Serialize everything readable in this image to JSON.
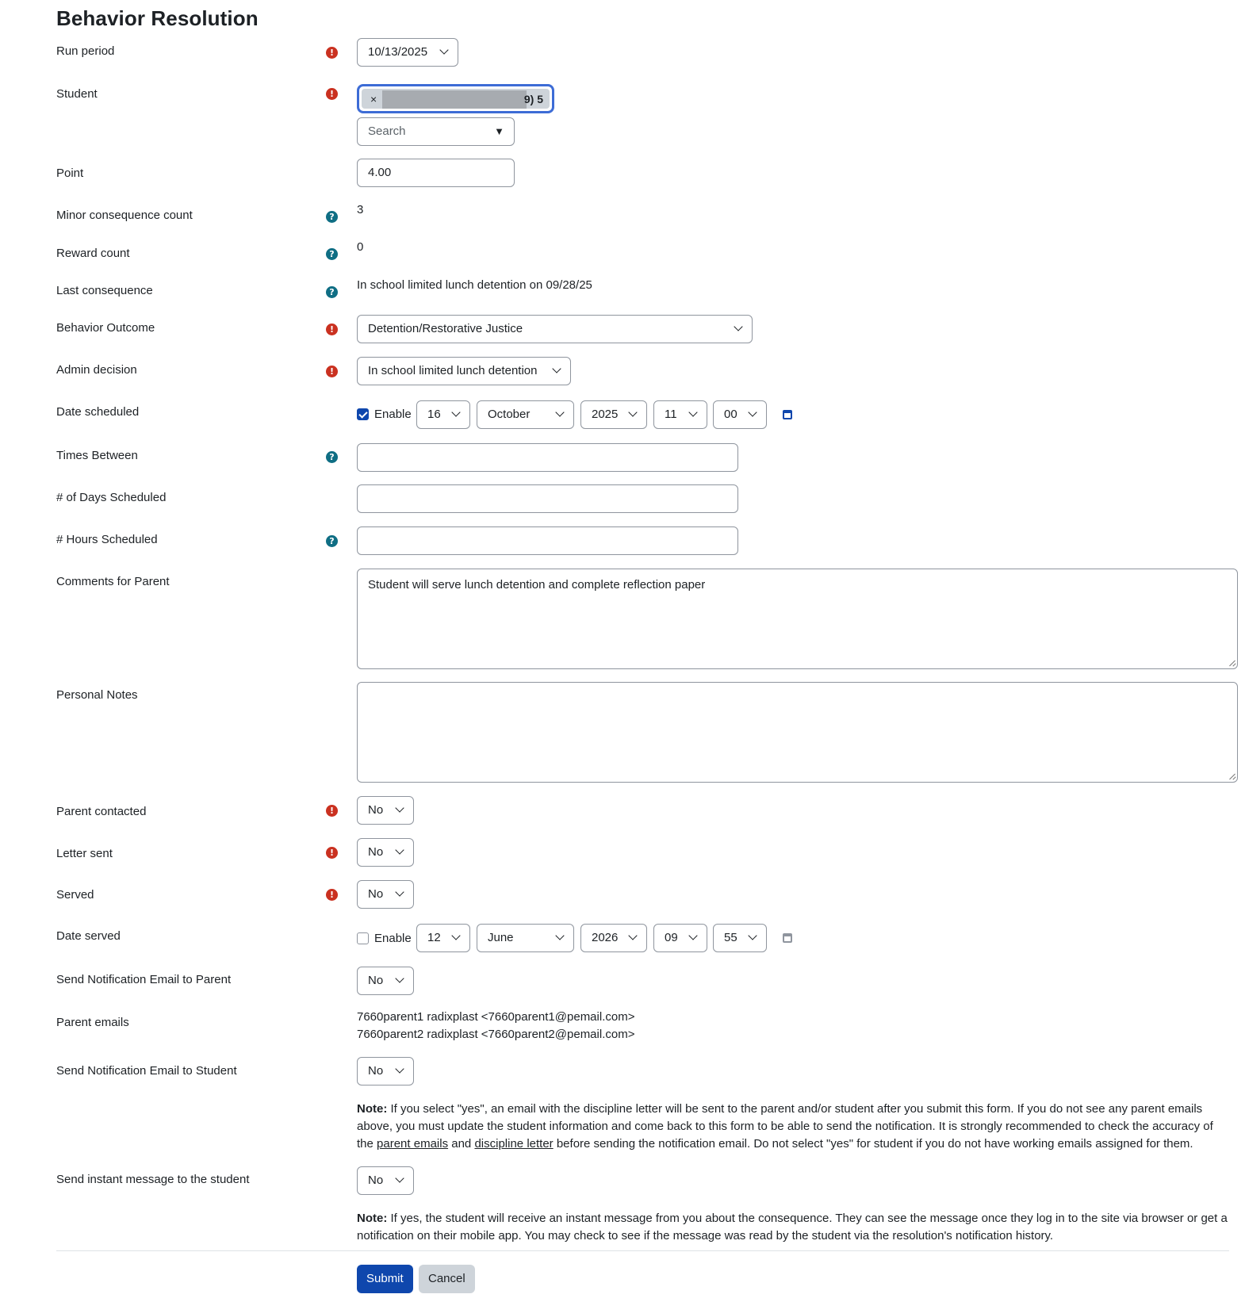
{
  "page": {
    "title": "Behavior Resolution"
  },
  "fields": {
    "run_period": {
      "label": "Run period",
      "value": "10/13/2025"
    },
    "student": {
      "label": "Student",
      "tag_suffix": "9) 5",
      "remove": "×",
      "search_placeholder": "Search",
      "search_arrow": "▼"
    },
    "point": {
      "label": "Point",
      "value": "4.00"
    },
    "minor_count": {
      "label": "Minor consequence count",
      "value": "3"
    },
    "reward_count": {
      "label": "Reward count",
      "value": "0"
    },
    "last_consequence": {
      "label": "Last consequence",
      "value": "In school limited lunch detention on 09/28/25"
    },
    "behavior_outcome": {
      "label": "Behavior Outcome",
      "value": "Detention/Restorative Justice"
    },
    "admin_decision": {
      "label": "Admin decision",
      "value": "In school limited lunch detention"
    },
    "date_scheduled": {
      "label": "Date scheduled",
      "enable_label": "Enable",
      "enabled": true,
      "day": "16",
      "month": "October",
      "year": "2025",
      "hour": "11",
      "minute": "00"
    },
    "times_between": {
      "label": "Times Between",
      "value": ""
    },
    "days_scheduled": {
      "label": "# of Days Scheduled",
      "value": ""
    },
    "hours_scheduled": {
      "label": "# Hours Scheduled",
      "value": ""
    },
    "comments_parent": {
      "label": "Comments for Parent",
      "value": "Student will serve lunch detention and complete reflection paper"
    },
    "personal_notes": {
      "label": "Personal Notes",
      "value": ""
    },
    "parent_contacted": {
      "label": "Parent contacted",
      "value": "No"
    },
    "letter_sent": {
      "label": "Letter sent",
      "value": "No"
    },
    "served": {
      "label": "Served",
      "value": "No"
    },
    "date_served": {
      "label": "Date served",
      "enable_label": "Enable",
      "enabled": false,
      "day": "12",
      "month": "June",
      "year": "2026",
      "hour": "09",
      "minute": "55"
    },
    "notify_parent": {
      "label": "Send Notification Email to Parent",
      "value": "No"
    },
    "parent_emails": {
      "label": "Parent emails",
      "lines": [
        "7660parent1 radixplast <7660parent1@pemail.com>",
        "7660parent2 radixplast <7660parent2@pemail.com>"
      ]
    },
    "notify_student": {
      "label": "Send Notification Email to Student",
      "value": "No"
    },
    "note1": {
      "bold": "Note:",
      "part1": " If you select \"yes\", an email with the discipline letter will be sent to the parent and/or student after you submit this form. If you do not see any parent emails above, you must update the student information and come back to this form to be able to send the notification. It is strongly recommended to check the accuracy of the ",
      "link1": "parent emails",
      "part2": " and ",
      "link2": "discipline letter",
      "part3": " before sending the notification email. Do not select \"yes\" for student if you do not have working emails assigned for them."
    },
    "instant_message": {
      "label": "Send instant message to the student",
      "value": "No"
    },
    "note2": {
      "bold": "Note:",
      "text": " If yes, the student will receive an instant message from you about the consequence. They can see the message once they log in to the site via browser or get a notification on their mobile app. You may check to see if the message was read by the student via the resolution's notification history."
    }
  },
  "icons": {
    "required": "!",
    "help": "?"
  },
  "buttons": {
    "submit": "Submit",
    "cancel": "Cancel"
  },
  "colors": {
    "primary": "#0f47ad",
    "required": "#ca3120",
    "help": "#0f6e84",
    "focus": "#3d6cd6"
  }
}
